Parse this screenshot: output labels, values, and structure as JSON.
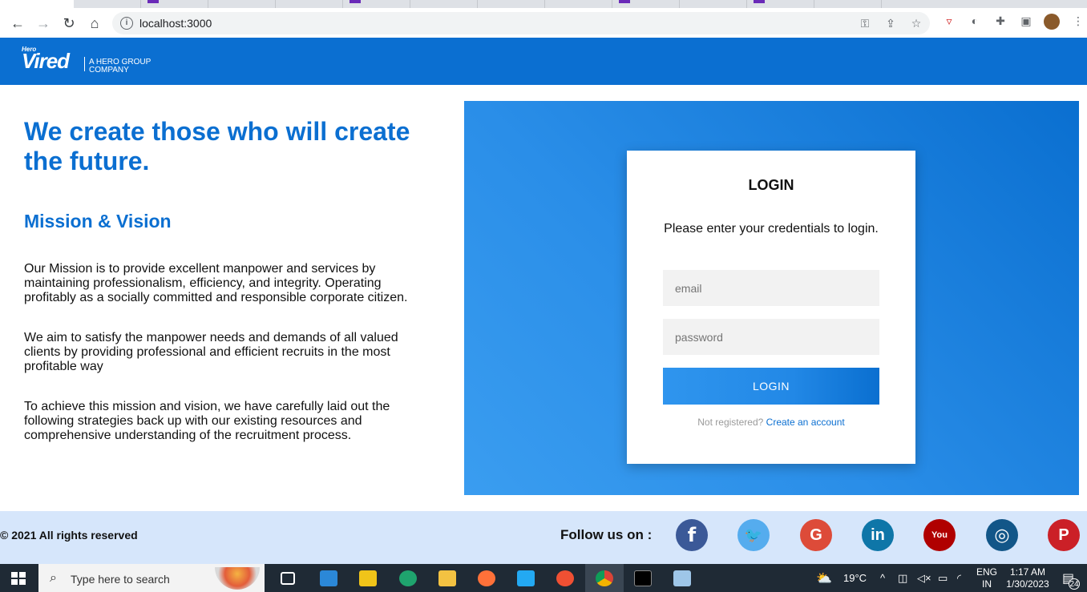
{
  "browser": {
    "url": "localhost:3000"
  },
  "header": {
    "logo_small": "Hero",
    "logo_main": "Vired",
    "logo_tagline_1": "A HERO GROUP",
    "logo_tagline_2": "COMPANY"
  },
  "main": {
    "headline": "We create those who will create the future.",
    "subheading": "Mission & Vision",
    "paragraphs": [
      "Our Mission is to provide excellent manpower and services by maintaining professionalism, efficiency, and integrity. Operating profitably as a socially committed and responsible corporate citizen.",
      "We aim to satisfy the manpower needs and demands of all valued clients by providing professional and efficient recruits in the most profitable way",
      "To achieve this mission and vision, we have carefully laid out the following strategies back up with our existing resources and comprehensive understanding of the recruitment process."
    ]
  },
  "login": {
    "title": "LOGIN",
    "description": "Please enter your credentials to login.",
    "email_placeholder": "email",
    "password_placeholder": "password",
    "button_label": "LOGIN",
    "register_prompt": "Not registered?",
    "register_link": "Create an account"
  },
  "footer": {
    "copyright": "© 2021 All rights reserved",
    "follow_label": "Follow us on :",
    "socials": [
      {
        "name": "facebook",
        "glyph": "f",
        "color": "#3b5998"
      },
      {
        "name": "twitter",
        "glyph": "🐦",
        "color": "#55acee"
      },
      {
        "name": "google",
        "glyph": "G",
        "color": "#dd4b39"
      },
      {
        "name": "linkedin",
        "glyph": "in",
        "color": "#0e76a8"
      },
      {
        "name": "youtube",
        "glyph": "You",
        "color": "#b00000"
      },
      {
        "name": "instagram",
        "glyph": "◎",
        "color": "#125688"
      },
      {
        "name": "pinterest",
        "glyph": "P",
        "color": "#cb2027"
      }
    ]
  },
  "taskbar": {
    "search_placeholder": "Type here to search",
    "temperature": "19°C",
    "lang_1": "ENG",
    "lang_2": "IN",
    "time": "1:17 AM",
    "date": "1/30/2023",
    "notifications": "24"
  }
}
